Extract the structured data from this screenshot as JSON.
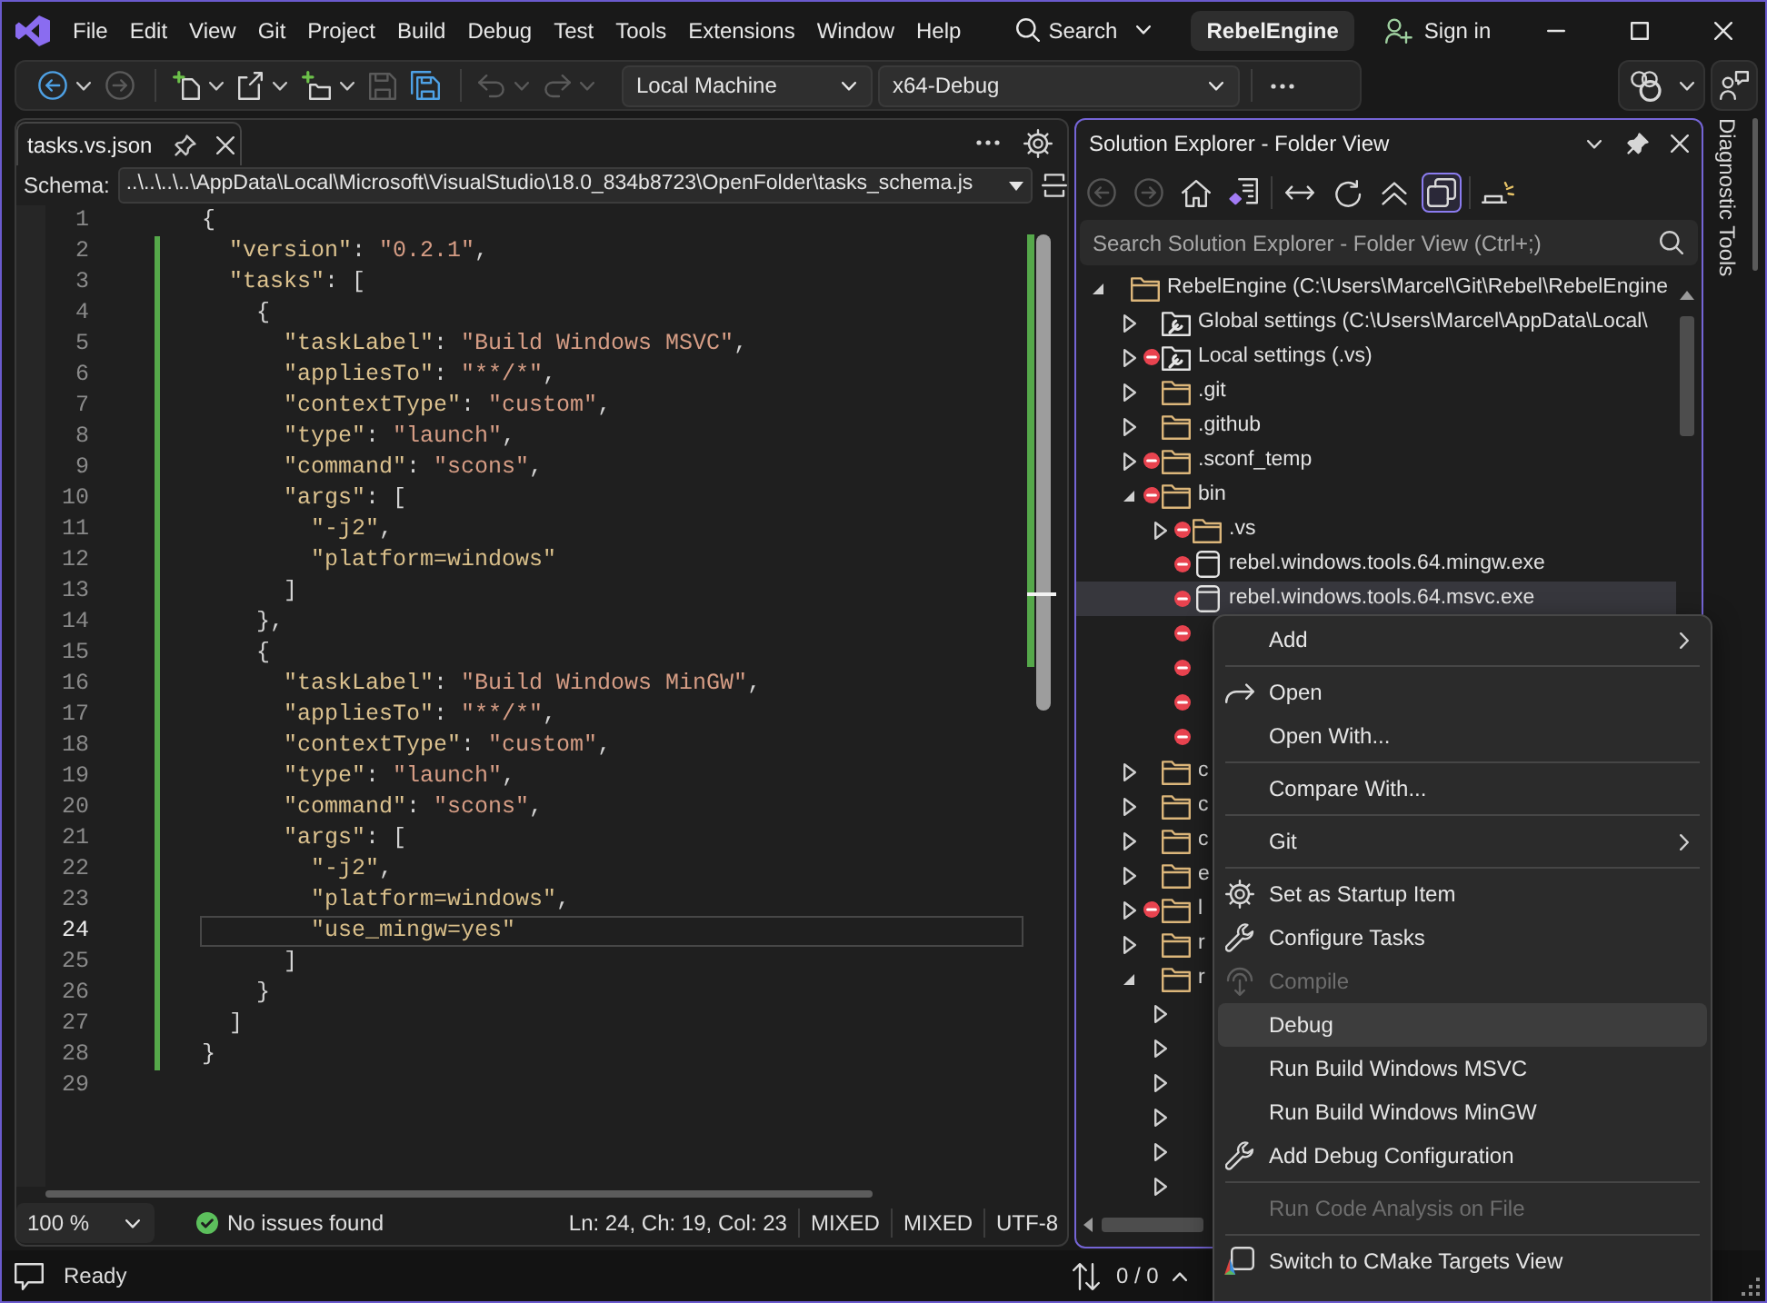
{
  "title_bar": {
    "menu": [
      "File",
      "Edit",
      "View",
      "Git",
      "Project",
      "Build",
      "Debug",
      "Test",
      "Tools",
      "Extensions",
      "Window",
      "Help"
    ],
    "search": "Search",
    "solution": "RebelEngine",
    "sign_in": "Sign in"
  },
  "toolbar": {
    "buttons": [
      {
        "kind": "back",
        "disabled": false
      },
      {
        "kind": "forward",
        "disabled": true
      },
      {
        "kind": "new_project",
        "disabled": false
      },
      {
        "kind": "new_file",
        "disabled": false
      },
      {
        "kind": "add_item",
        "disabled": false
      },
      {
        "kind": "save",
        "disabled": true
      },
      {
        "kind": "save_all",
        "disabled": false
      },
      {
        "kind": "undo",
        "disabled": true
      },
      {
        "kind": "redo",
        "disabled": true
      }
    ],
    "target": "Local Machine",
    "configuration": "x64-Debug"
  },
  "editor": {
    "tab": {
      "label": "tasks.vs.json",
      "selected": true
    },
    "schema": {
      "label": "Schema:",
      "value": "..\\..\\..\\..\\AppData\\Local\\Microsoft\\VisualStudio\\18.0_834b8723\\OpenFolder\\tasks_schema.js"
    },
    "lines": [
      {
        "number": "1",
        "changed": false,
        "current": false,
        "tokens": [
          {
            "kind": "punct",
            "text": "{"
          }
        ]
      },
      {
        "number": "2",
        "changed": true,
        "current": false,
        "tokens": [
          {
            "kind": "key",
            "text": "  \"version\""
          },
          {
            "kind": "punct",
            "text": ": "
          },
          {
            "kind": "string",
            "text": "\"0.2.1\""
          },
          {
            "kind": "punct",
            "text": ","
          }
        ]
      },
      {
        "number": "3",
        "changed": true,
        "current": false,
        "tokens": [
          {
            "kind": "key",
            "text": "  \"tasks\""
          },
          {
            "kind": "punct",
            "text": ": ["
          }
        ]
      },
      {
        "number": "4",
        "changed": true,
        "current": false,
        "tokens": [
          {
            "kind": "punct",
            "text": "    {"
          }
        ]
      },
      {
        "number": "5",
        "changed": true,
        "current": false,
        "tokens": [
          {
            "kind": "key",
            "text": "      \"taskLabel\""
          },
          {
            "kind": "punct",
            "text": ": "
          },
          {
            "kind": "string",
            "text": "\"Build Windows MSVC\""
          },
          {
            "kind": "punct",
            "text": ","
          }
        ]
      },
      {
        "number": "6",
        "changed": true,
        "current": false,
        "tokens": [
          {
            "kind": "key",
            "text": "      \"appliesTo\""
          },
          {
            "kind": "punct",
            "text": ": "
          },
          {
            "kind": "string",
            "text": "\"**/*\""
          },
          {
            "kind": "punct",
            "text": ","
          }
        ]
      },
      {
        "number": "7",
        "changed": true,
        "current": false,
        "tokens": [
          {
            "kind": "key",
            "text": "      \"contextType\""
          },
          {
            "kind": "punct",
            "text": ": "
          },
          {
            "kind": "string",
            "text": "\"custom\""
          },
          {
            "kind": "punct",
            "text": ","
          }
        ]
      },
      {
        "number": "8",
        "changed": true,
        "current": false,
        "tokens": [
          {
            "kind": "key",
            "text": "      \"type\""
          },
          {
            "kind": "punct",
            "text": ": "
          },
          {
            "kind": "string",
            "text": "\"launch\""
          },
          {
            "kind": "punct",
            "text": ","
          }
        ]
      },
      {
        "number": "9",
        "changed": true,
        "current": false,
        "tokens": [
          {
            "kind": "key",
            "text": "      \"command\""
          },
          {
            "kind": "punct",
            "text": ": "
          },
          {
            "kind": "string",
            "text": "\"scons\""
          },
          {
            "kind": "punct",
            "text": ","
          }
        ]
      },
      {
        "number": "10",
        "changed": true,
        "current": false,
        "tokens": [
          {
            "kind": "key",
            "text": "      \"args\""
          },
          {
            "kind": "punct",
            "text": ": ["
          }
        ]
      },
      {
        "number": "11",
        "changed": true,
        "current": false,
        "tokens": [
          {
            "kind": "item",
            "text": "        \"-j2\""
          },
          {
            "kind": "punct",
            "text": ","
          }
        ]
      },
      {
        "number": "12",
        "changed": true,
        "current": false,
        "tokens": [
          {
            "kind": "item",
            "text": "        \"platform=windows\""
          }
        ]
      },
      {
        "number": "13",
        "changed": true,
        "current": false,
        "tokens": [
          {
            "kind": "punct",
            "text": "      ]"
          }
        ]
      },
      {
        "number": "14",
        "changed": true,
        "current": false,
        "tokens": [
          {
            "kind": "punct",
            "text": "    },"
          }
        ]
      },
      {
        "number": "15",
        "changed": true,
        "current": false,
        "tokens": [
          {
            "kind": "punct",
            "text": "    {"
          }
        ]
      },
      {
        "number": "16",
        "changed": true,
        "current": false,
        "tokens": [
          {
            "kind": "key",
            "text": "      \"taskLabel\""
          },
          {
            "kind": "punct",
            "text": ": "
          },
          {
            "kind": "string",
            "text": "\"Build Windows MinGW\""
          },
          {
            "kind": "punct",
            "text": ","
          }
        ]
      },
      {
        "number": "17",
        "changed": true,
        "current": false,
        "tokens": [
          {
            "kind": "key",
            "text": "      \"appliesTo\""
          },
          {
            "kind": "punct",
            "text": ": "
          },
          {
            "kind": "string",
            "text": "\"**/*\""
          },
          {
            "kind": "punct",
            "text": ","
          }
        ]
      },
      {
        "number": "18",
        "changed": true,
        "current": false,
        "tokens": [
          {
            "kind": "key",
            "text": "      \"contextType\""
          },
          {
            "kind": "punct",
            "text": ": "
          },
          {
            "kind": "string",
            "text": "\"custom\""
          },
          {
            "kind": "punct",
            "text": ","
          }
        ]
      },
      {
        "number": "19",
        "changed": true,
        "current": false,
        "tokens": [
          {
            "kind": "key",
            "text": "      \"type\""
          },
          {
            "kind": "punct",
            "text": ": "
          },
          {
            "kind": "string",
            "text": "\"launch\""
          },
          {
            "kind": "punct",
            "text": ","
          }
        ]
      },
      {
        "number": "20",
        "changed": true,
        "current": false,
        "tokens": [
          {
            "kind": "key",
            "text": "      \"command\""
          },
          {
            "kind": "punct",
            "text": ": "
          },
          {
            "kind": "string",
            "text": "\"scons\""
          },
          {
            "kind": "punct",
            "text": ","
          }
        ]
      },
      {
        "number": "21",
        "changed": true,
        "current": false,
        "tokens": [
          {
            "kind": "key",
            "text": "      \"args\""
          },
          {
            "kind": "punct",
            "text": ": ["
          }
        ]
      },
      {
        "number": "22",
        "changed": true,
        "current": false,
        "tokens": [
          {
            "kind": "item",
            "text": "        \"-j2\""
          },
          {
            "kind": "punct",
            "text": ","
          }
        ]
      },
      {
        "number": "23",
        "changed": true,
        "current": false,
        "tokens": [
          {
            "kind": "item",
            "text": "        \"platform=windows\""
          },
          {
            "kind": "punct",
            "text": ","
          }
        ]
      },
      {
        "number": "24",
        "changed": true,
        "current": true,
        "tokens": [
          {
            "kind": "item",
            "text": "        \"use_mingw=yes\""
          }
        ]
      },
      {
        "number": "25",
        "changed": true,
        "current": false,
        "tokens": [
          {
            "kind": "punct",
            "text": "      ]"
          }
        ]
      },
      {
        "number": "26",
        "changed": true,
        "current": false,
        "tokens": [
          {
            "kind": "punct",
            "text": "    }"
          }
        ]
      },
      {
        "number": "27",
        "changed": true,
        "current": false,
        "tokens": [
          {
            "kind": "punct",
            "text": "  ]"
          }
        ]
      },
      {
        "number": "28",
        "changed": true,
        "current": false,
        "tokens": [
          {
            "kind": "punct",
            "text": "}"
          }
        ]
      },
      {
        "number": "29",
        "changed": false,
        "current": false
      }
    ],
    "status": {
      "zoom": "100 %",
      "issues": "No issues found",
      "position": "Ln: 24, Ch: 19, Col: 23",
      "fields": [
        "MIXED",
        "MIXED",
        "UTF-8"
      ]
    }
  },
  "solution_explorer": {
    "title": "Solution Explorer - Folder View",
    "toolbar": [
      {
        "kind": "back",
        "disabled": true,
        "on": false
      },
      {
        "kind": "forward",
        "disabled": true,
        "on": false
      },
      {
        "kind": "home",
        "disabled": false,
        "on": false
      },
      {
        "kind": "switch_views",
        "disabled": false,
        "on": false
      },
      {
        "kind": "sync",
        "disabled": false,
        "on": false
      },
      {
        "kind": "refresh",
        "disabled": false,
        "on": false
      },
      {
        "kind": "collapse_all",
        "disabled": false,
        "on": false
      },
      {
        "kind": "show_all_files",
        "disabled": false,
        "on": true
      },
      {
        "kind": "preview",
        "disabled": false,
        "on": false
      }
    ],
    "search": {
      "placeholder": "Search Solution Explorer - Folder View (Ctrl+;)"
    },
    "tree": [
      {
        "label": "RebelEngine (C:\\Users\\Marcel\\Git\\Rebel\\RebelEngine",
        "kind": "folder",
        "expanded": true,
        "excluded": false,
        "selected": false,
        "children": [
          {
            "label": "Global settings (C:\\Users\\Marcel\\AppData\\Local\\",
            "kind": "settings",
            "expanded": false,
            "excluded": false,
            "selected": false
          },
          {
            "label": "Local settings (.vs)",
            "kind": "settings",
            "expanded": false,
            "excluded": true,
            "selected": false
          },
          {
            "label": ".git",
            "kind": "folder",
            "expanded": false,
            "excluded": false,
            "selected": false
          },
          {
            "label": ".github",
            "kind": "folder",
            "expanded": false,
            "excluded": false,
            "selected": false
          },
          {
            "label": ".sconf_temp",
            "kind": "folder",
            "expanded": false,
            "excluded": true,
            "selected": false
          },
          {
            "label": "bin",
            "kind": "folder",
            "expanded": true,
            "excluded": true,
            "selected": false,
            "children": [
              {
                "label": ".vs",
                "kind": "folder",
                "expanded": false,
                "excluded": true,
                "selected": false
              },
              {
                "label": "rebel.windows.tools.64.mingw.exe",
                "kind": "file",
                "excluded": true,
                "selected": false
              },
              {
                "label": "rebel.windows.tools.64.msvc.exe",
                "kind": "file",
                "excluded": true,
                "selected": true
              },
              {
                "excluded": true,
                "selected": false
              },
              {
                "excluded": true,
                "selected": false
              },
              {
                "excluded": true,
                "selected": false
              },
              {
                "excluded": true,
                "selected": false
              }
            ]
          },
          {
            "label": "c",
            "kind": "folder",
            "expanded": false,
            "excluded": false,
            "selected": false
          },
          {
            "label": "c",
            "kind": "folder",
            "expanded": false,
            "excluded": false,
            "selected": false
          },
          {
            "label": "c",
            "kind": "folder",
            "expanded": false,
            "excluded": false,
            "selected": false
          },
          {
            "label": "e",
            "kind": "folder",
            "expanded": false,
            "excluded": false,
            "selected": false
          },
          {
            "label": "l",
            "kind": "folder",
            "expanded": false,
            "excluded": true,
            "selected": false
          },
          {
            "label": "r",
            "kind": "folder",
            "expanded": false,
            "excluded": false,
            "selected": false
          },
          {
            "label": "r",
            "kind": "folder",
            "expanded": true,
            "excluded": false,
            "selected": false,
            "children": [
              {
                "expanded": false,
                "excluded": false,
                "selected": false
              },
              {
                "expanded": false,
                "excluded": false,
                "selected": false
              },
              {
                "expanded": false,
                "excluded": false,
                "selected": false
              },
              {
                "expanded": false,
                "excluded": false,
                "selected": false
              },
              {
                "expanded": false,
                "excluded": false,
                "selected": false
              },
              {
                "expanded": false,
                "excluded": false,
                "selected": false
              }
            ]
          }
        ]
      }
    ]
  },
  "side_tab": {
    "label": "Diagnostic Tools"
  },
  "context_menu": {
    "groups": [
      [
        {
          "label": "Add",
          "kind": "submenu",
          "disabled": false,
          "selected": false
        }
      ],
      [
        {
          "label": "Open",
          "kind": "open",
          "disabled": false,
          "selected": false
        },
        {
          "label": "Open With...",
          "kind": "plain",
          "disabled": false,
          "selected": false
        }
      ],
      [
        {
          "label": "Compare With...",
          "kind": "plain",
          "disabled": false,
          "selected": false
        }
      ],
      [
        {
          "label": "Git",
          "kind": "submenu",
          "disabled": false,
          "selected": false
        }
      ],
      [
        {
          "label": "Set as Startup Item",
          "kind": "startup",
          "disabled": false,
          "selected": false
        },
        {
          "label": "Configure Tasks",
          "kind": "configure",
          "disabled": false,
          "selected": false
        },
        {
          "label": "Compile",
          "kind": "compile",
          "disabled": true,
          "selected": false
        },
        {
          "label": "Debug",
          "kind": "plain",
          "disabled": false,
          "selected": true
        },
        {
          "label": "Run Build Windows MSVC",
          "kind": "plain",
          "disabled": false,
          "selected": false
        },
        {
          "label": "Run Build Windows MinGW",
          "kind": "plain",
          "disabled": false,
          "selected": false
        },
        {
          "label": "Add Debug Configuration",
          "kind": "configure",
          "disabled": false,
          "selected": false
        }
      ],
      [
        {
          "label": "Run Code Analysis on File",
          "kind": "plain",
          "disabled": true,
          "selected": false
        }
      ],
      [
        {
          "label": "Switch to CMake Targets View",
          "kind": "cmake",
          "disabled": false,
          "selected": false
        }
      ]
    ]
  },
  "status_bar": {
    "text": "Ready",
    "changes": "0 / 0"
  }
}
